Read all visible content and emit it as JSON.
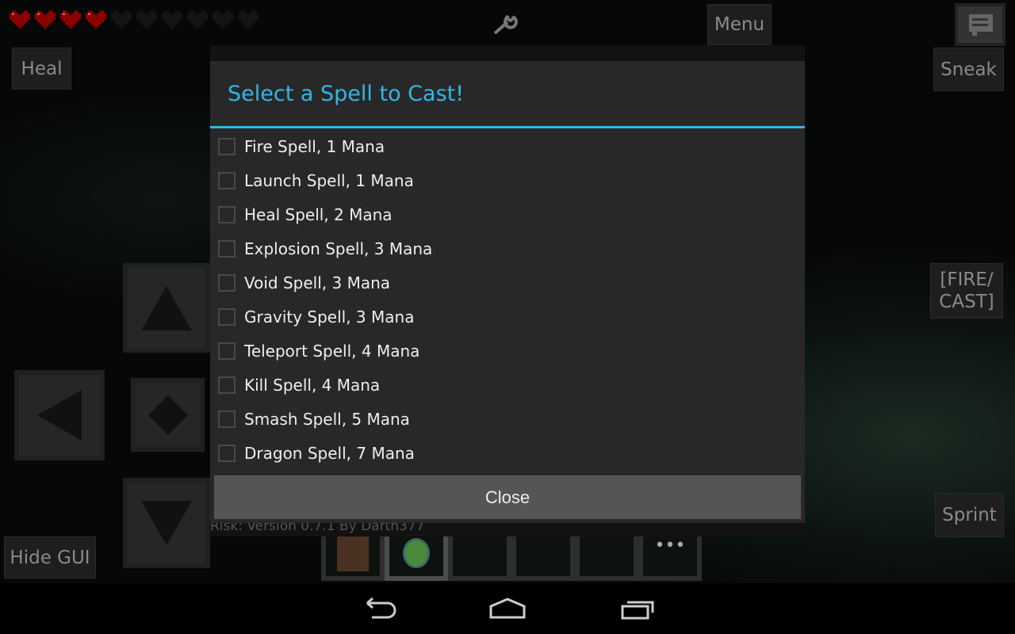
{
  "hud": {
    "hearts_total": 10,
    "hearts_full": 4,
    "heal": "Heal",
    "menu": "Menu",
    "sneak": "Sneak",
    "fire_cast": "[FIRE/ CAST]",
    "sprint": "Sprint",
    "hide_gui": "Hide GUI"
  },
  "dialog": {
    "title": "Select a Spell to Cast!",
    "close": "Close",
    "spells": [
      {
        "label": "Fire Spell, 1 Mana",
        "checked": false
      },
      {
        "label": "Launch Spell, 1 Mana",
        "checked": false
      },
      {
        "label": "Heal Spell, 2 Mana",
        "checked": false
      },
      {
        "label": "Explosion Spell, 3 Mana",
        "checked": false
      },
      {
        "label": "Void Spell, 3 Mana",
        "checked": false
      },
      {
        "label": "Gravity Spell, 3 Mana",
        "checked": false
      },
      {
        "label": "Teleport Spell, 4 Mana",
        "checked": false
      },
      {
        "label": "Kill Spell, 4 Mana",
        "checked": false
      },
      {
        "label": "Smash Spell, 5 Mana",
        "checked": false
      },
      {
        "label": "Dragon Spell, 7 Mana",
        "checked": false
      }
    ]
  },
  "footer": "Risk: Version 0.7.1 By Darth377",
  "hotbar": [
    {
      "item": "dirt-block"
    },
    {
      "item": "ender-eye",
      "selected": true
    },
    {
      "item": ""
    },
    {
      "item": ""
    },
    {
      "item": ""
    },
    {
      "item": "more-dots"
    }
  ],
  "colors": {
    "accent": "#33b5e5",
    "heart": "#8b0000"
  }
}
